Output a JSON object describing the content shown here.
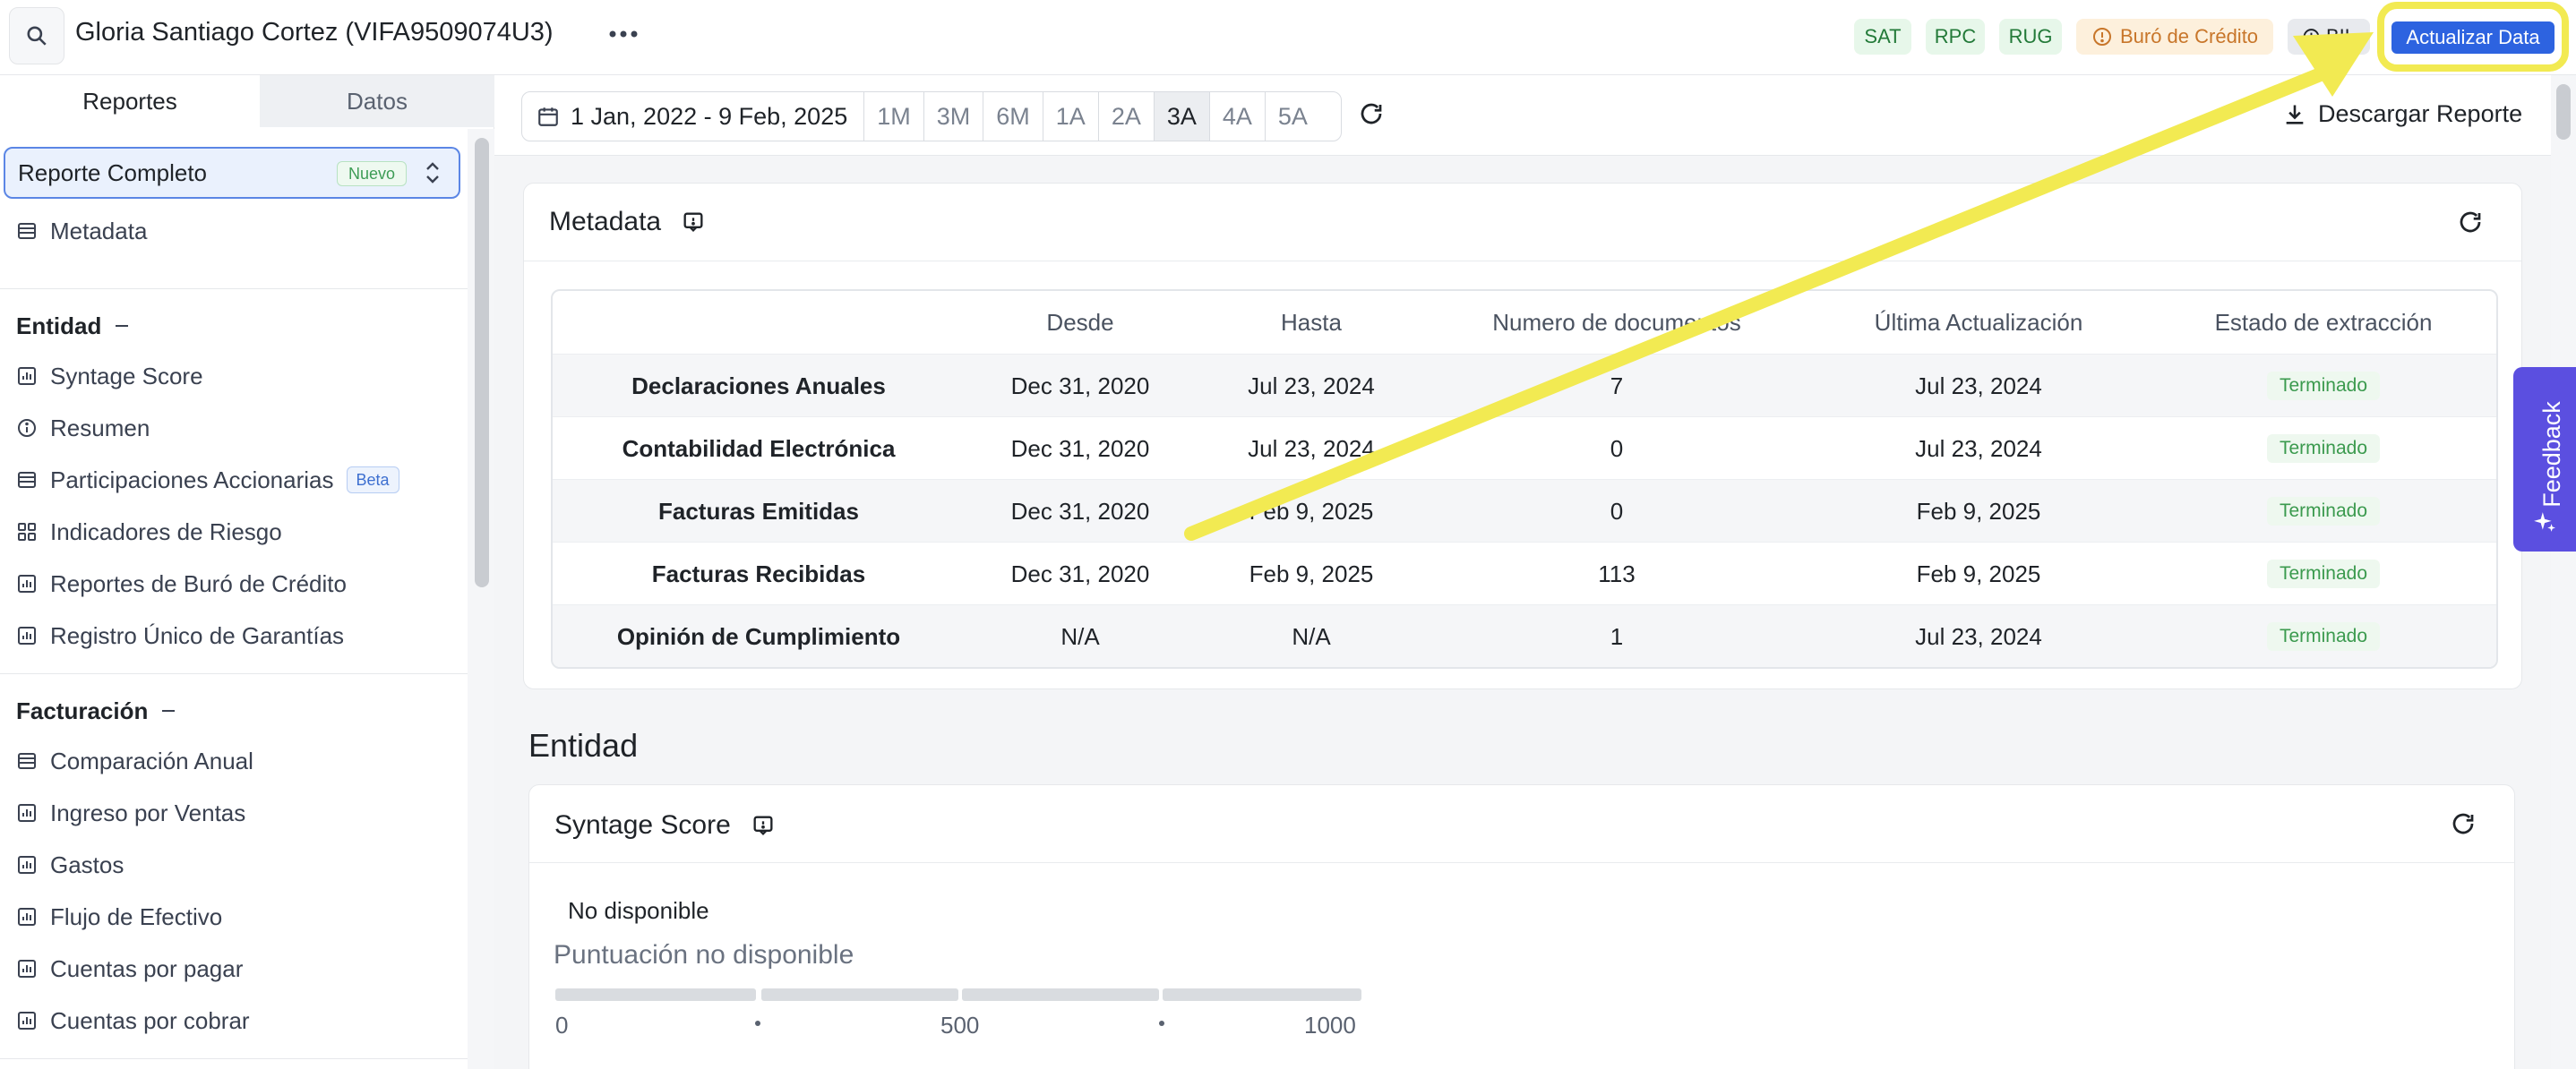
{
  "header": {
    "title": "Gloria Santiago Cortez (VIFA9509074U3)",
    "badges": {
      "sat": "SAT",
      "rpc": "RPC",
      "rug": "RUG",
      "buro": "Buró de Crédito",
      "bil": "BIL"
    },
    "update_label": "Actualizar Data"
  },
  "sidebar": {
    "tabs": [
      "Reportes",
      "Datos"
    ],
    "report_select": {
      "value": "Reporte Completo",
      "badge": "Nuevo"
    },
    "metadata_item": "Metadata",
    "entidad": {
      "heading": "Entidad",
      "items": [
        "Syntage Score",
        "Resumen",
        "Participaciones Accionarias",
        "Indicadores de Riesgo",
        "Reportes de Buró de Crédito",
        "Registro Único de Garantías"
      ],
      "beta_badge": "Beta"
    },
    "facturacion": {
      "heading": "Facturación",
      "items": [
        "Comparación Anual",
        "Ingreso por Ventas",
        "Gastos",
        "Flujo de Efectivo",
        "Cuentas por pagar",
        "Cuentas por cobrar"
      ]
    }
  },
  "toolbar": {
    "date_range": "1 Jan, 2022 - 9 Feb, 2025",
    "ranges": [
      "1M",
      "3M",
      "6M",
      "1A",
      "2A",
      "3A",
      "4A",
      "5A"
    ],
    "active_range": "3A",
    "download_label": "Descargar Reporte"
  },
  "metadata": {
    "title": "Metadata",
    "columns": [
      "",
      "Desde",
      "Hasta",
      "Numero de documentos",
      "Última Actualización",
      "Estado de extracción"
    ],
    "rows": [
      [
        "Declaraciones Anuales",
        "Dec 31, 2020",
        "Jul 23, 2024",
        "7",
        "Jul 23, 2024",
        "Terminado"
      ],
      [
        "Contabilidad Electrónica",
        "Dec 31, 2020",
        "Jul 23, 2024",
        "0",
        "Jul 23, 2024",
        "Terminado"
      ],
      [
        "Facturas Emitidas",
        "Dec 31, 2020",
        "Feb 9, 2025",
        "0",
        "Feb 9, 2025",
        "Terminado"
      ],
      [
        "Facturas Recibidas",
        "Dec 31, 2020",
        "Feb 9, 2025",
        "113",
        "Feb 9, 2025",
        "Terminado"
      ],
      [
        "Opinión de Cumplimiento",
        "N/A",
        "N/A",
        "1",
        "Jul 23, 2024",
        "Terminado"
      ]
    ]
  },
  "entidad_section": {
    "heading": "Entidad",
    "score_card": {
      "title": "Syntage Score",
      "status": "No disponible",
      "text": "Puntuación no disponible",
      "ticks": [
        "0",
        "500",
        "1000"
      ]
    }
  },
  "feedback_label": "Feedback",
  "colors": {
    "accent": "#2d63e0",
    "highlight": "#f2ea52",
    "feedback": "#5b4fe0",
    "status_green": "#3b9a4e"
  }
}
